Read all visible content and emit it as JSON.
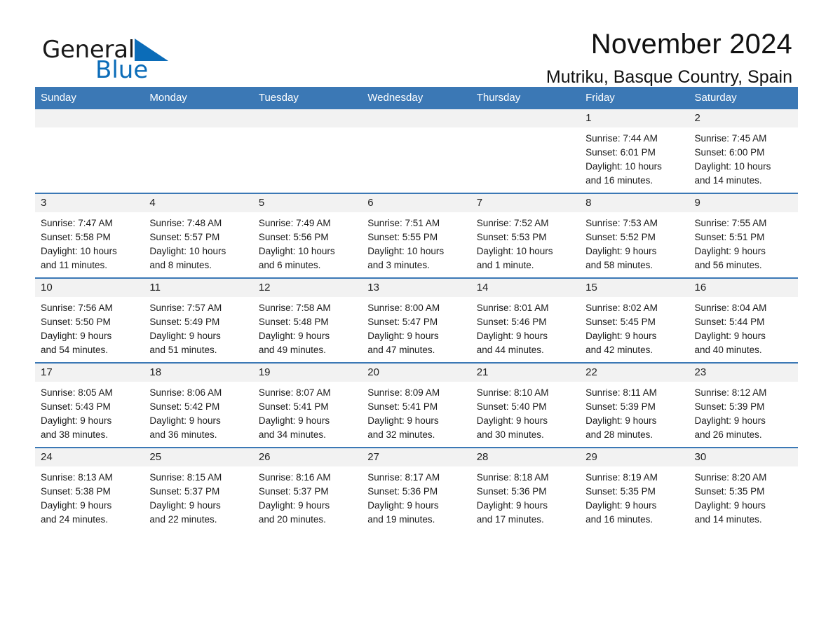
{
  "brand": {
    "name_part1": "General",
    "name_part2": "Blue",
    "logo_icon": "blue-triangle-icon",
    "accent_color": "#0b6cb8"
  },
  "header": {
    "title": "November 2024",
    "subtitle": "Mutriku, Basque Country, Spain"
  },
  "theme": {
    "header_blue": "#3b78b5",
    "daynum_gray": "#f2f2f2"
  },
  "weekday_headers": [
    "Sunday",
    "Monday",
    "Tuesday",
    "Wednesday",
    "Thursday",
    "Friday",
    "Saturday"
  ],
  "weeks": [
    [
      {
        "day": "",
        "blank": true
      },
      {
        "day": "",
        "blank": true
      },
      {
        "day": "",
        "blank": true
      },
      {
        "day": "",
        "blank": true
      },
      {
        "day": "",
        "blank": true
      },
      {
        "day": "1",
        "sunrise": "Sunrise: 7:44 AM",
        "sunset": "Sunset: 6:01 PM",
        "daylight_line1": "Daylight: 10 hours",
        "daylight_line2": "and 16 minutes."
      },
      {
        "day": "2",
        "sunrise": "Sunrise: 7:45 AM",
        "sunset": "Sunset: 6:00 PM",
        "daylight_line1": "Daylight: 10 hours",
        "daylight_line2": "and 14 minutes."
      }
    ],
    [
      {
        "day": "3",
        "sunrise": "Sunrise: 7:47 AM",
        "sunset": "Sunset: 5:58 PM",
        "daylight_line1": "Daylight: 10 hours",
        "daylight_line2": "and 11 minutes."
      },
      {
        "day": "4",
        "sunrise": "Sunrise: 7:48 AM",
        "sunset": "Sunset: 5:57 PM",
        "daylight_line1": "Daylight: 10 hours",
        "daylight_line2": "and 8 minutes."
      },
      {
        "day": "5",
        "sunrise": "Sunrise: 7:49 AM",
        "sunset": "Sunset: 5:56 PM",
        "daylight_line1": "Daylight: 10 hours",
        "daylight_line2": "and 6 minutes."
      },
      {
        "day": "6",
        "sunrise": "Sunrise: 7:51 AM",
        "sunset": "Sunset: 5:55 PM",
        "daylight_line1": "Daylight: 10 hours",
        "daylight_line2": "and 3 minutes."
      },
      {
        "day": "7",
        "sunrise": "Sunrise: 7:52 AM",
        "sunset": "Sunset: 5:53 PM",
        "daylight_line1": "Daylight: 10 hours",
        "daylight_line2": "and 1 minute."
      },
      {
        "day": "8",
        "sunrise": "Sunrise: 7:53 AM",
        "sunset": "Sunset: 5:52 PM",
        "daylight_line1": "Daylight: 9 hours",
        "daylight_line2": "and 58 minutes."
      },
      {
        "day": "9",
        "sunrise": "Sunrise: 7:55 AM",
        "sunset": "Sunset: 5:51 PM",
        "daylight_line1": "Daylight: 9 hours",
        "daylight_line2": "and 56 minutes."
      }
    ],
    [
      {
        "day": "10",
        "sunrise": "Sunrise: 7:56 AM",
        "sunset": "Sunset: 5:50 PM",
        "daylight_line1": "Daylight: 9 hours",
        "daylight_line2": "and 54 minutes."
      },
      {
        "day": "11",
        "sunrise": "Sunrise: 7:57 AM",
        "sunset": "Sunset: 5:49 PM",
        "daylight_line1": "Daylight: 9 hours",
        "daylight_line2": "and 51 minutes."
      },
      {
        "day": "12",
        "sunrise": "Sunrise: 7:58 AM",
        "sunset": "Sunset: 5:48 PM",
        "daylight_line1": "Daylight: 9 hours",
        "daylight_line2": "and 49 minutes."
      },
      {
        "day": "13",
        "sunrise": "Sunrise: 8:00 AM",
        "sunset": "Sunset: 5:47 PM",
        "daylight_line1": "Daylight: 9 hours",
        "daylight_line2": "and 47 minutes."
      },
      {
        "day": "14",
        "sunrise": "Sunrise: 8:01 AM",
        "sunset": "Sunset: 5:46 PM",
        "daylight_line1": "Daylight: 9 hours",
        "daylight_line2": "and 44 minutes."
      },
      {
        "day": "15",
        "sunrise": "Sunrise: 8:02 AM",
        "sunset": "Sunset: 5:45 PM",
        "daylight_line1": "Daylight: 9 hours",
        "daylight_line2": "and 42 minutes."
      },
      {
        "day": "16",
        "sunrise": "Sunrise: 8:04 AM",
        "sunset": "Sunset: 5:44 PM",
        "daylight_line1": "Daylight: 9 hours",
        "daylight_line2": "and 40 minutes."
      }
    ],
    [
      {
        "day": "17",
        "sunrise": "Sunrise: 8:05 AM",
        "sunset": "Sunset: 5:43 PM",
        "daylight_line1": "Daylight: 9 hours",
        "daylight_line2": "and 38 minutes."
      },
      {
        "day": "18",
        "sunrise": "Sunrise: 8:06 AM",
        "sunset": "Sunset: 5:42 PM",
        "daylight_line1": "Daylight: 9 hours",
        "daylight_line2": "and 36 minutes."
      },
      {
        "day": "19",
        "sunrise": "Sunrise: 8:07 AM",
        "sunset": "Sunset: 5:41 PM",
        "daylight_line1": "Daylight: 9 hours",
        "daylight_line2": "and 34 minutes."
      },
      {
        "day": "20",
        "sunrise": "Sunrise: 8:09 AM",
        "sunset": "Sunset: 5:41 PM",
        "daylight_line1": "Daylight: 9 hours",
        "daylight_line2": "and 32 minutes."
      },
      {
        "day": "21",
        "sunrise": "Sunrise: 8:10 AM",
        "sunset": "Sunset: 5:40 PM",
        "daylight_line1": "Daylight: 9 hours",
        "daylight_line2": "and 30 minutes."
      },
      {
        "day": "22",
        "sunrise": "Sunrise: 8:11 AM",
        "sunset": "Sunset: 5:39 PM",
        "daylight_line1": "Daylight: 9 hours",
        "daylight_line2": "and 28 minutes."
      },
      {
        "day": "23",
        "sunrise": "Sunrise: 8:12 AM",
        "sunset": "Sunset: 5:39 PM",
        "daylight_line1": "Daylight: 9 hours",
        "daylight_line2": "and 26 minutes."
      }
    ],
    [
      {
        "day": "24",
        "sunrise": "Sunrise: 8:13 AM",
        "sunset": "Sunset: 5:38 PM",
        "daylight_line1": "Daylight: 9 hours",
        "daylight_line2": "and 24 minutes."
      },
      {
        "day": "25",
        "sunrise": "Sunrise: 8:15 AM",
        "sunset": "Sunset: 5:37 PM",
        "daylight_line1": "Daylight: 9 hours",
        "daylight_line2": "and 22 minutes."
      },
      {
        "day": "26",
        "sunrise": "Sunrise: 8:16 AM",
        "sunset": "Sunset: 5:37 PM",
        "daylight_line1": "Daylight: 9 hours",
        "daylight_line2": "and 20 minutes."
      },
      {
        "day": "27",
        "sunrise": "Sunrise: 8:17 AM",
        "sunset": "Sunset: 5:36 PM",
        "daylight_line1": "Daylight: 9 hours",
        "daylight_line2": "and 19 minutes."
      },
      {
        "day": "28",
        "sunrise": "Sunrise: 8:18 AM",
        "sunset": "Sunset: 5:36 PM",
        "daylight_line1": "Daylight: 9 hours",
        "daylight_line2": "and 17 minutes."
      },
      {
        "day": "29",
        "sunrise": "Sunrise: 8:19 AM",
        "sunset": "Sunset: 5:35 PM",
        "daylight_line1": "Daylight: 9 hours",
        "daylight_line2": "and 16 minutes."
      },
      {
        "day": "30",
        "sunrise": "Sunrise: 8:20 AM",
        "sunset": "Sunset: 5:35 PM",
        "daylight_line1": "Daylight: 9 hours",
        "daylight_line2": "and 14 minutes."
      }
    ]
  ]
}
